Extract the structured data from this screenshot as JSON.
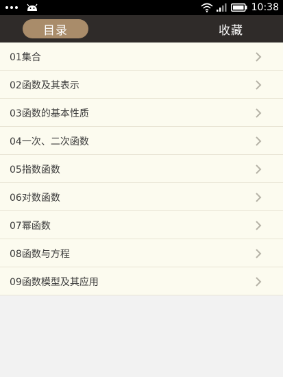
{
  "status_bar": {
    "time": "10:38",
    "icons": [
      "dots-icon",
      "android-icon",
      "wifi-icon",
      "signal-icon",
      "battery-icon"
    ]
  },
  "tabs": [
    {
      "label": "目录",
      "active": true
    },
    {
      "label": "收藏",
      "active": false
    }
  ],
  "chapters": [
    {
      "label": "01集合"
    },
    {
      "label": "02函数及其表示"
    },
    {
      "label": "03函数的基本性质"
    },
    {
      "label": "04一次、二次函数"
    },
    {
      "label": "05指数函数"
    },
    {
      "label": "06对数函数"
    },
    {
      "label": "07幂函数"
    },
    {
      "label": "08函数与方程"
    },
    {
      "label": "09函数模型及其应用"
    }
  ],
  "colors": {
    "header_bg": "#2f2b29",
    "active_tab": "#a98c6a",
    "list_bg": "#fcfbef",
    "page_bg": "#f2f2f2"
  }
}
